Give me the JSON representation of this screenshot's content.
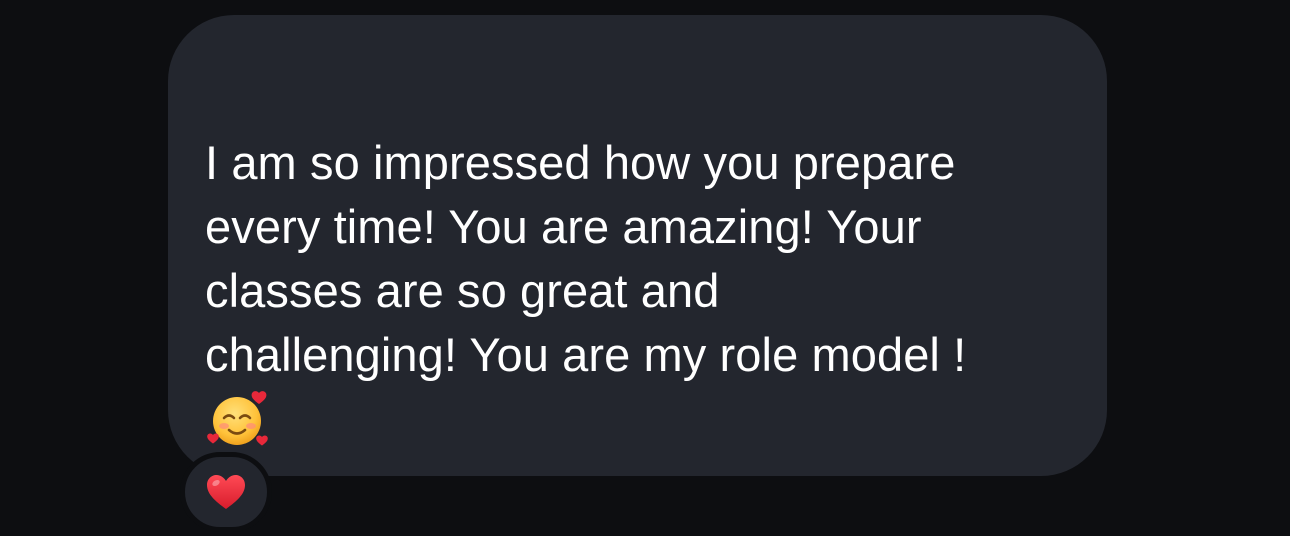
{
  "message": {
    "lines": [
      "I am so impressed how you prepare",
      "every time! You are amazing! Your",
      "classes are so great and",
      "challenging! You are my role model !"
    ],
    "emoji": "smiling-face-with-hearts",
    "reaction": "red-heart"
  },
  "colors": {
    "background": "#0d0e11",
    "bubble": "#23262e",
    "text": "#ffffff",
    "heart": "#e0242f",
    "emoji_face": "#ffc83d"
  }
}
